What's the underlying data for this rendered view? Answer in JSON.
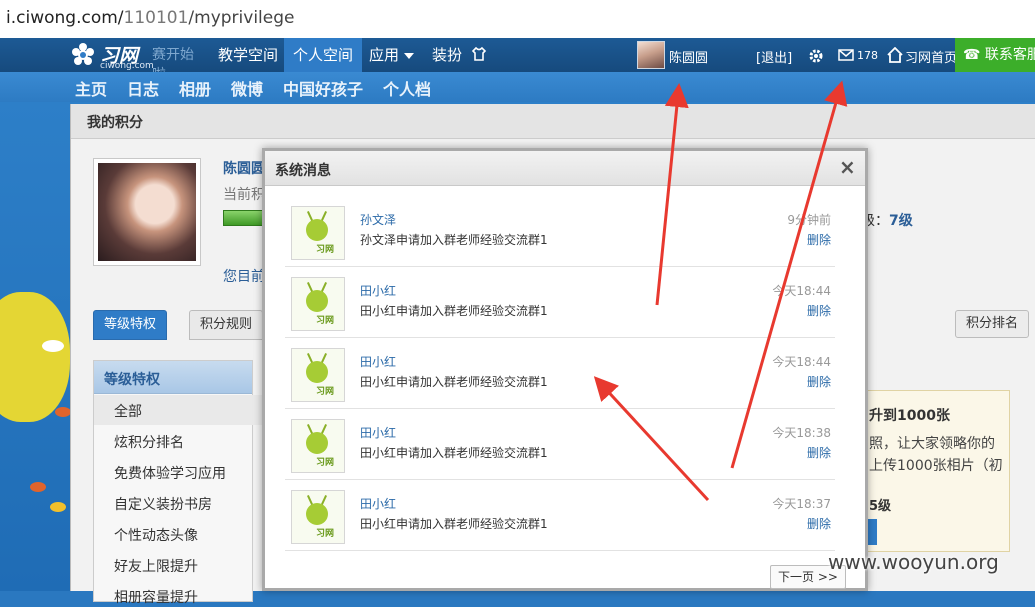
{
  "url": {
    "domain": "i.ciwong.com/",
    "path": "110101",
    "rest": "/myprivilege"
  },
  "logo": {
    "brand": "习网",
    "domain": "ciwong.com",
    "slogan": "赛开始啦"
  },
  "topnav": {
    "items": [
      {
        "label": "教学空间"
      },
      {
        "label": "个人空间",
        "active": true
      },
      {
        "label": "应用"
      },
      {
        "label": "装扮"
      }
    ],
    "user_name": "陈圆圆",
    "logout": "[退出]",
    "mail_count": "178",
    "home_label": "习网首页",
    "contact_label": "联系客服"
  },
  "subnav": [
    "主页",
    "日志",
    "相册",
    "微博",
    "中国好孩子",
    "个人档"
  ],
  "panel": {
    "title": "我的积分",
    "profile_name": "陈圆圆",
    "current_points_label": "当前积",
    "now_label": "您目前",
    "level_label": "级：",
    "level_value": "7级",
    "tabs": [
      "等级特权",
      "积分规则"
    ],
    "rank_button": "积分排名"
  },
  "side": {
    "title": "等级特权",
    "items": [
      "全部",
      "炫积分排名",
      "免费体验学习应用",
      "自定义装扮书房",
      "个性动态头像",
      "好友上限提升",
      "相册容量提升"
    ]
  },
  "promo": {
    "title": "升到1000张",
    "line1": "照，让大家领略你的",
    "line2": "上传1000张相片（初",
    "level": "5级"
  },
  "dialog": {
    "title": "系统消息",
    "close_label": "×",
    "messages": [
      {
        "from": "孙文泽",
        "body": "孙文泽申请加入群老师经验交流群1",
        "time": "9分钟前",
        "delete": "删除"
      },
      {
        "from": "田小红",
        "body": "田小红申请加入群老师经验交流群1",
        "time": "今天18:44",
        "delete": "删除"
      },
      {
        "from": "田小红",
        "body": "田小红申请加入群老师经验交流群1",
        "time": "今天18:44",
        "delete": "删除"
      },
      {
        "from": "田小红",
        "body": "田小红申请加入群老师经验交流群1",
        "time": "今天18:38",
        "delete": "删除"
      },
      {
        "from": "田小红",
        "body": "田小红申请加入群老师经验交流群1",
        "time": "今天18:37",
        "delete": "删除"
      }
    ],
    "icon_label": "习网",
    "next_label": "下一页 >>"
  },
  "watermark": "www.wooyun.org",
  "colors": {
    "nav_bg": "#164a7d",
    "accent": "#2f7cc7",
    "contact": "#3cae2a",
    "arrow": "#e8392f"
  }
}
